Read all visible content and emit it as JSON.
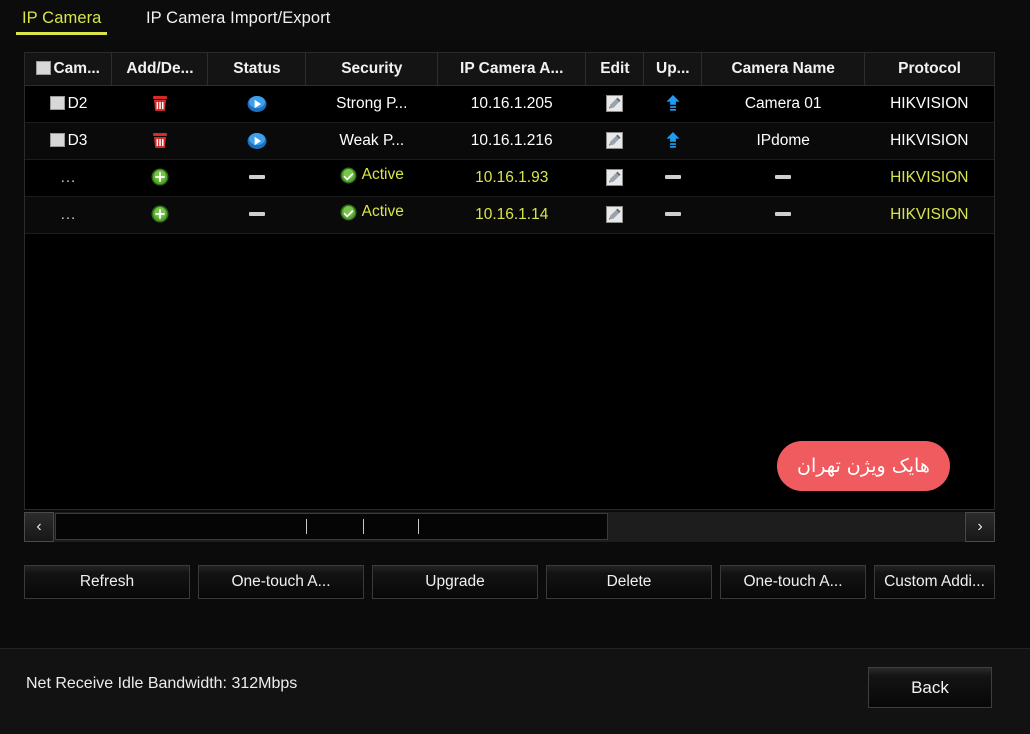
{
  "tabs": [
    {
      "id": "ip-camera",
      "label": "IP Camera",
      "active": true
    },
    {
      "id": "ip-camera-import-export",
      "label": "IP Camera Import/Export",
      "active": false
    }
  ],
  "table": {
    "headers": [
      "Cam...",
      "Add/De...",
      "Status",
      "Security",
      "IP Camera A...",
      "Edit",
      "Up...",
      "Camera Name",
      "Protocol"
    ],
    "rows": [
      {
        "camera": "D2",
        "checkbox": true,
        "add_delete_icon": "delete-trash-icon",
        "status_icon": "play-icon",
        "security": "Strong P...",
        "security_icon": null,
        "ip_address": "10.16.1.205",
        "edit_icon": "edit-pencil-icon",
        "upgrade_icon": "upgrade-arrow-icon",
        "camera_name": "Camera 01",
        "protocol": "HIKVISION",
        "highlight": false
      },
      {
        "camera": "D3",
        "checkbox": true,
        "add_delete_icon": "delete-trash-icon",
        "status_icon": "play-icon",
        "security": "Weak P...",
        "security_icon": null,
        "ip_address": "10.16.1.216",
        "edit_icon": "edit-pencil-icon",
        "upgrade_icon": "upgrade-arrow-icon",
        "camera_name": "IPdome",
        "protocol": "HIKVISION",
        "highlight": false
      },
      {
        "camera": "...",
        "checkbox": false,
        "add_delete_icon": "add-plus-icon",
        "status_icon": "dash-icon",
        "security": "Active",
        "security_icon": "active-check-icon",
        "ip_address": "10.16.1.93",
        "edit_icon": "edit-pencil-icon",
        "upgrade_icon": "dash-icon",
        "camera_name": "—",
        "protocol": "HIKVISION",
        "highlight": true
      },
      {
        "camera": "...",
        "checkbox": false,
        "add_delete_icon": "add-plus-icon",
        "status_icon": "dash-icon",
        "security": "Active",
        "security_icon": "active-check-icon",
        "ip_address": "10.16.1.14",
        "edit_icon": "edit-pencil-icon",
        "upgrade_icon": "dash-icon",
        "camera_name": "—",
        "protocol": "HIKVISION",
        "highlight": true
      }
    ]
  },
  "scrollbar": {
    "left_arrow": "‹",
    "right_arrow": "›"
  },
  "buttons": [
    {
      "id": "refresh",
      "label": "Refresh"
    },
    {
      "id": "one-touch-activate",
      "label": "One-touch A..."
    },
    {
      "id": "upgrade",
      "label": "Upgrade"
    },
    {
      "id": "delete",
      "label": "Delete"
    },
    {
      "id": "one-touch-adding",
      "label": "One-touch A..."
    },
    {
      "id": "custom-adding",
      "label": "Custom Addi..."
    }
  ],
  "status_bar": {
    "bandwidth_text": "Net Receive Idle Bandwidth: 312Mbps",
    "back_label": "Back"
  },
  "watermark": {
    "text": "هایک ویژن تهران"
  },
  "colors": {
    "accent_yellow": "#d9e54a",
    "delete_red": "#d42a2a",
    "add_green": "#4caf2a",
    "play_blue": "#2a8fe0",
    "upgrade_blue": "#1f9bf0",
    "active_green": "#5aa832",
    "watermark_bg": "#ef5b5f",
    "background": "#0b0b0b"
  }
}
